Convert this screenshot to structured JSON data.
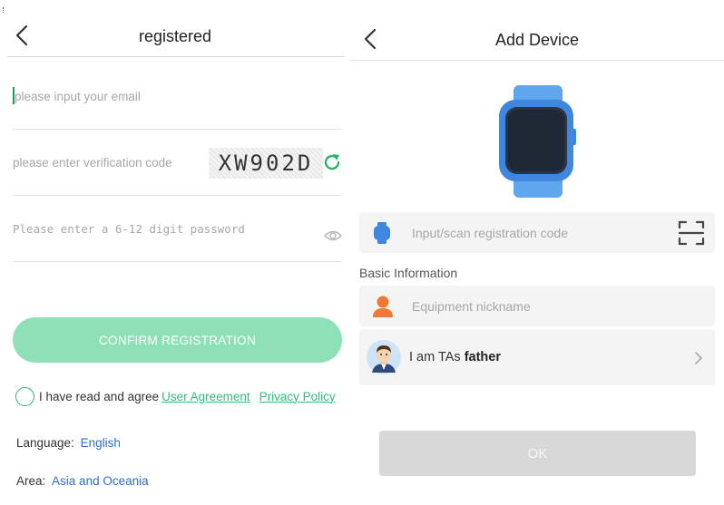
{
  "register": {
    "title": "registered",
    "email_placeholder": "please input your email",
    "code_placeholder": "please enter verification code",
    "captcha_text": "XW902D",
    "password_placeholder": "Please enter a 6-12 digit password",
    "confirm_label": "CONFIRM REGISTRATION",
    "agree_text": "I have read and agree",
    "user_agreement": "User Agreement",
    "privacy_policy": "Privacy Policy",
    "language_label": "Language:",
    "language_value": "English",
    "area_label": "Area:",
    "area_value": "Asia and Oceania"
  },
  "add_device": {
    "title": "Add Device",
    "reg_code_placeholder": "Input/scan registration code",
    "section_label": "Basic Information",
    "nickname_placeholder": "Equipment nickname",
    "relation_prefix": "I am TAs",
    "relation_value": "father",
    "ok_label": "OK"
  },
  "icons": {
    "back": "chevron-left-icon",
    "refresh": "refresh-icon",
    "eye": "eye-icon",
    "watch": "smartwatch-icon",
    "scan": "scan-icon",
    "person": "person-icon",
    "avatar": "father-avatar",
    "chevron": "chevron-right-icon"
  },
  "colors": {
    "confirm_button": "#8ee0b6",
    "link_green": "#2fbf78",
    "link_blue": "#2a6fd6",
    "watch_blue": "#4a90e2",
    "person_orange": "#f07a35",
    "ok_disabled": "#d8d8d8"
  }
}
